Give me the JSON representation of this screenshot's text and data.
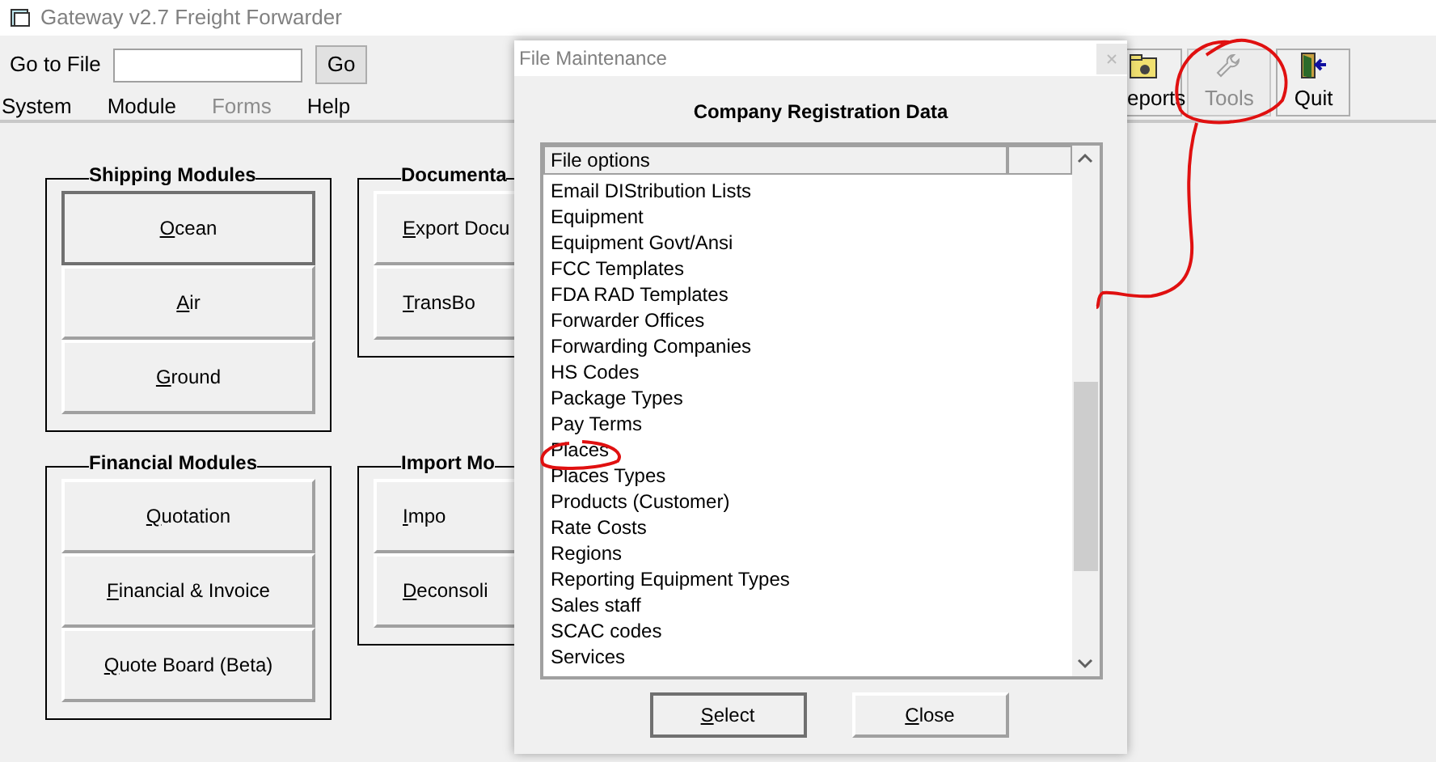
{
  "window": {
    "title": "Gateway  v2.7  Freight Forwarder"
  },
  "toolbar": {
    "goto_label": "Go to File",
    "goto_button": "Go",
    "buttons": [
      {
        "label": "eports",
        "disabled": false
      },
      {
        "label": "Tools",
        "disabled": true
      },
      {
        "label": "Quit",
        "disabled": false
      }
    ]
  },
  "menu": [
    {
      "label": "System",
      "disabled": false
    },
    {
      "label": "Module",
      "disabled": false
    },
    {
      "label": "Forms",
      "disabled": true
    },
    {
      "label": "Help",
      "disabled": false
    }
  ],
  "groups": [
    {
      "title": "Shipping Modules",
      "buttons": [
        {
          "label": "Ocean",
          "focused": true
        },
        {
          "label": "Air",
          "focused": false
        },
        {
          "label": "Ground",
          "focused": false
        }
      ]
    },
    {
      "title": "Documenta",
      "buttons": [
        {
          "label": "Export Docu",
          "focused": false
        },
        {
          "label": "TransBo",
          "focused": false
        }
      ]
    },
    {
      "title": "Financial Modules",
      "buttons": [
        {
          "label": "Quotation",
          "focused": false
        },
        {
          "label": "Financial & Invoice",
          "focused": false
        },
        {
          "label": "Quote Board (Beta)",
          "focused": false
        }
      ]
    },
    {
      "title": "Import Mo",
      "buttons": [
        {
          "label": "Impo",
          "focused": false
        },
        {
          "label": "Deconsoli",
          "focused": false
        }
      ]
    }
  ],
  "dialog": {
    "title": "File Maintenance",
    "heading": "Company Registration Data",
    "columns": [
      "File options"
    ],
    "items": [
      "Email DIStribution Lists",
      "Equipment",
      "Equipment Govt/Ansi",
      "FCC Templates",
      "FDA RAD Templates",
      "Forwarder Offices",
      "Forwarding Companies",
      "HS Codes",
      "Package Types",
      "Pay Terms",
      "Places",
      "Places Types",
      "Products (Customer)",
      "Rate Costs",
      "Regions",
      "Reporting Equipment Types",
      "Sales staff",
      "SCAC codes",
      "Services"
    ],
    "buttons": [
      {
        "label": "Select",
        "default": true
      },
      {
        "label": "Close",
        "default": false
      }
    ]
  }
}
